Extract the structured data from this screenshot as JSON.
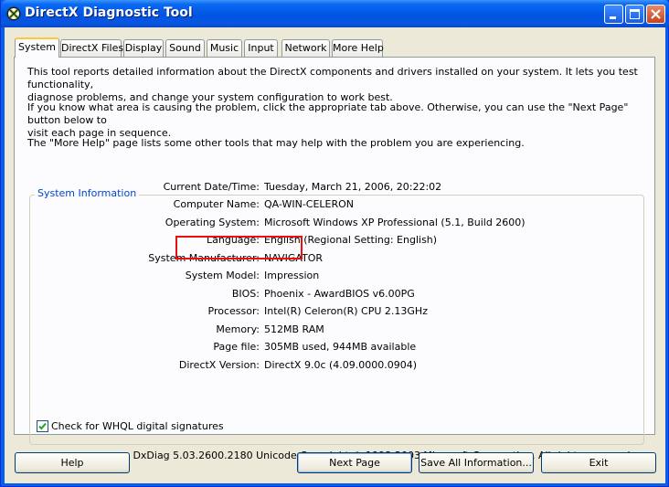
{
  "window": {
    "title": "DirectX Diagnostic Tool"
  },
  "tabs": [
    {
      "label": "System"
    },
    {
      "label": "DirectX Files"
    },
    {
      "label": "Display"
    },
    {
      "label": "Sound"
    },
    {
      "label": "Music"
    },
    {
      "label": "Input"
    },
    {
      "label": "Network"
    },
    {
      "label": "More Help"
    }
  ],
  "intro": {
    "p1_line1": "This tool reports detailed information about the DirectX components and drivers installed on your system.  It lets you test functionality,",
    "p1_line2": "diagnose problems, and change your system configuration to work best.",
    "p2_line1": "If you know what area is causing the problem, click the appropriate tab above.  Otherwise, you can use the \"Next Page\" button below to",
    "p2_line2": "visit each page in sequence.",
    "p3": "The \"More Help\" page lists some other tools that may help with the problem you are experiencing."
  },
  "system_info": {
    "group_title": "System Information",
    "rows": [
      {
        "label": "Current Date/Time:",
        "value": "Tuesday, March 21, 2006, 20:22:02"
      },
      {
        "label": "Computer Name:",
        "value": "QA-WIN-CELERON"
      },
      {
        "label": "Operating System:",
        "value": "Microsoft Windows XP Professional (5.1, Build 2600)"
      },
      {
        "label": "Language:",
        "value": "English (Regional Setting: English)"
      },
      {
        "label": "System Manufacturer:",
        "value": "NAVIGATOR"
      },
      {
        "label": "System Model:",
        "value": "Impression"
      },
      {
        "label": "BIOS:",
        "value": "Phoenix - AwardBIOS v6.00PG"
      },
      {
        "label": "Processor:",
        "value": "Intel(R) Celeron(R) CPU 2.13GHz"
      },
      {
        "label": "Memory:",
        "value": "512MB RAM"
      },
      {
        "label": "Page file:",
        "value": "305MB used, 944MB available"
      },
      {
        "label": "DirectX Version:",
        "value": "DirectX 9.0c (4.09.0000.0904)"
      }
    ]
  },
  "whql": {
    "label": "Check for WHQL digital signatures",
    "checked": true
  },
  "footer": "DxDiag 5.03.2600.2180 Unicode  Copyright © 1998-2003 Microsoft Corporation.  All rights reserved.",
  "buttons": {
    "help": "Help",
    "next_page": "Next Page",
    "save_all": "Save All Information...",
    "exit": "Exit"
  },
  "colors": {
    "title_bar": "#0054e3",
    "highlight_box": "#e81010",
    "group_title": "#0046d5"
  }
}
